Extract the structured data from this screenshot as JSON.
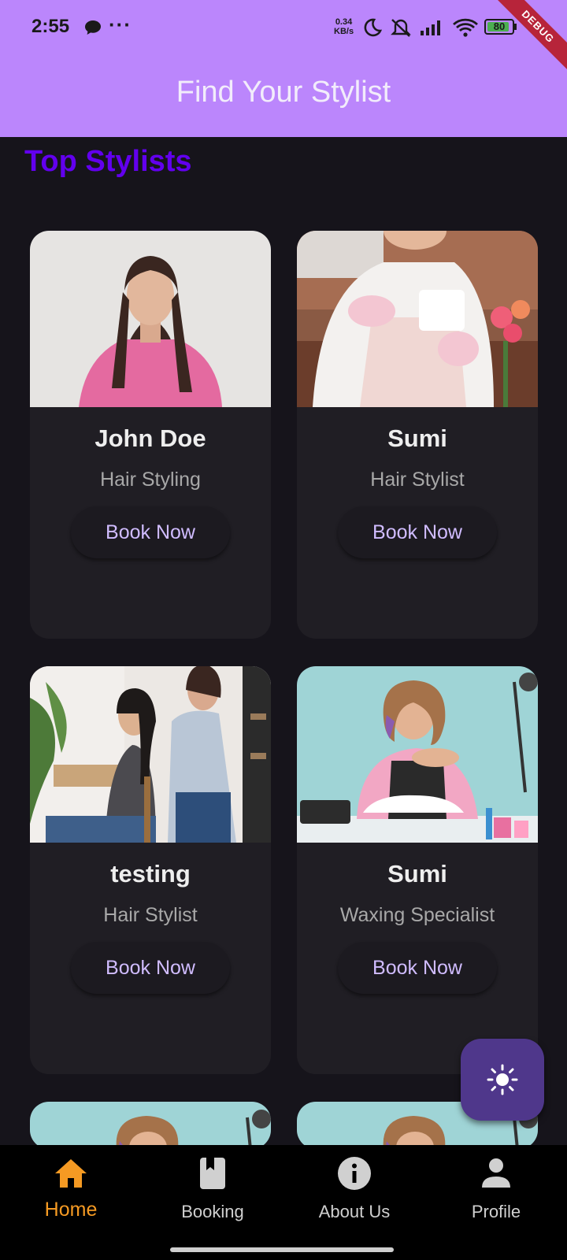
{
  "status_bar": {
    "time": "2:55",
    "more": "···",
    "speed_value": "0.34",
    "speed_unit": "KB/s",
    "battery": "80",
    "debug_label": "DEBUG"
  },
  "app_bar": {
    "title": "Find Your Stylist"
  },
  "section": {
    "title": "Top Stylists"
  },
  "stylists": [
    {
      "name": "John Doe",
      "specialty": "Hair Styling",
      "book_label": "Book Now"
    },
    {
      "name": "Sumi",
      "specialty": "Hair Stylist",
      "book_label": "Book Now"
    },
    {
      "name": "testing",
      "specialty": "Hair Stylist",
      "book_label": "Book Now"
    },
    {
      "name": "Sumi",
      "specialty": "Waxing Specialist",
      "book_label": "Book Now"
    }
  ],
  "fab": {
    "icon": "sun-icon"
  },
  "bottom_nav": {
    "items": [
      {
        "label": "Home",
        "icon": "home-icon",
        "active": true
      },
      {
        "label": "Booking",
        "icon": "book-icon",
        "active": false
      },
      {
        "label": "About Us",
        "icon": "info-icon",
        "active": false
      },
      {
        "label": "Profile",
        "icon": "person-icon",
        "active": false
      }
    ]
  },
  "colors": {
    "app_bar": "#bb86fc",
    "background": "#16141b",
    "card": "#201e24",
    "section_title": "#6200ee",
    "button_text": "#d0bcff",
    "nav_active": "#f59a23",
    "fab": "#4f378b"
  }
}
